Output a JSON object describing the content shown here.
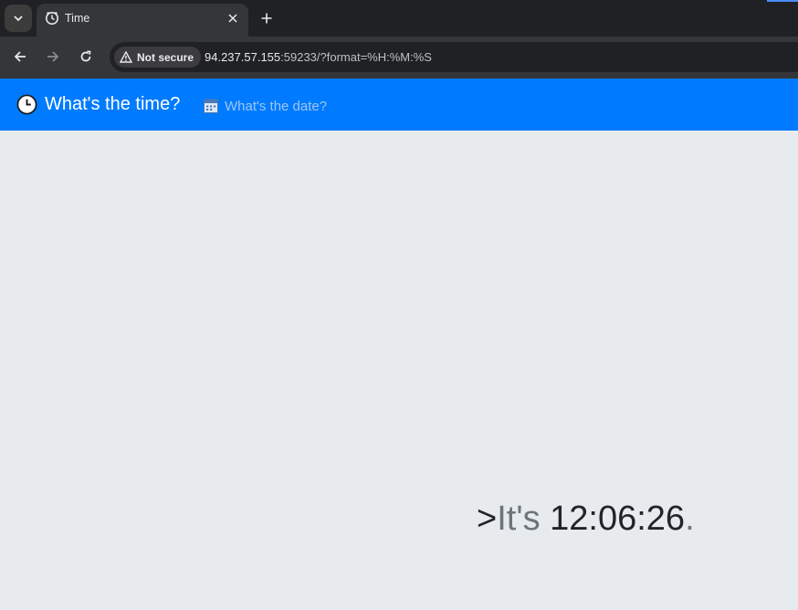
{
  "browser": {
    "tab": {
      "title": "Time"
    },
    "security_label": "Not secure",
    "url_host": "94.237.57.155",
    "url_rest": ":59233/?format=%H:%M:%S"
  },
  "navbar": {
    "brand_label": "What's the time?",
    "link_label": "What's the date?"
  },
  "main": {
    "prefix": ">",
    "lead": "It's",
    "time": "12:06:26",
    "suffix": "."
  },
  "colors": {
    "navbar": "#007bff",
    "page_background": "#e8ebee",
    "muted_text": "#6c757d",
    "time_text": "#212529"
  }
}
